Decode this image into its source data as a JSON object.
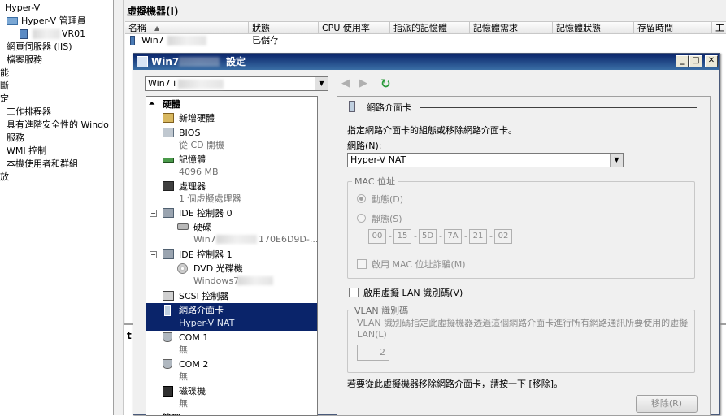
{
  "left_tree": {
    "items": [
      {
        "label": "Hyper-V",
        "indent": 6
      },
      {
        "label": "Hyper-V 管理員",
        "indent": 26
      },
      {
        "label": "VR01",
        "indent": 76
      },
      {
        "label": "網頁伺服器 (IIS)",
        "indent": 8
      },
      {
        "label": "檔案服務",
        "indent": 8
      },
      {
        "label": "能",
        "indent": 0
      },
      {
        "label": "斷",
        "indent": 0
      },
      {
        "label": "定",
        "indent": 0
      },
      {
        "label": "工作排程器",
        "indent": 8
      },
      {
        "label": "具有進階安全性的 Windo",
        "indent": 8
      },
      {
        "label": "服務",
        "indent": 8
      },
      {
        "label": "WMI 控制",
        "indent": 8
      },
      {
        "label": "本機使用者和群組",
        "indent": 8
      },
      {
        "label": "放",
        "indent": 0
      }
    ]
  },
  "vm_panel": {
    "title": "虛擬機器(I)",
    "columns": [
      "名稱",
      "狀態",
      "CPU 使用率",
      "指派的記憶體",
      "記憶體需求",
      "記憶體狀態",
      "存留時間",
      "工"
    ],
    "rows": [
      {
        "name": "Win7",
        "status": "已儲存"
      }
    ],
    "lower_pane_label": "t"
  },
  "dialog": {
    "title_left": "Win7",
    "title_right": "設定",
    "vm_select_value": "Win7 i",
    "window_buttons": {
      "minimize": "_",
      "maximize": "□",
      "close": "✕"
    },
    "hardware": [
      {
        "label": "硬體",
        "type": "section"
      },
      {
        "label": "新增硬體",
        "sub": ""
      },
      {
        "label": "BIOS",
        "sub": "從 CD 開機"
      },
      {
        "label": "記憶體",
        "sub": "4096 MB"
      },
      {
        "label": "處理器",
        "sub": "1 個虛擬處理器"
      },
      {
        "label": "IDE 控制器 0",
        "sub": ""
      },
      {
        "label": "硬碟",
        "sub": "Win7",
        "sub2": "170E6D9D-..."
      },
      {
        "label": "IDE 控制器 1",
        "sub": ""
      },
      {
        "label": "DVD 光碟機",
        "sub": "Windows7"
      },
      {
        "label": "SCSI 控制器",
        "sub": ""
      },
      {
        "label": "網路介面卡",
        "sub": "Hyper-V NAT"
      },
      {
        "label": "COM 1",
        "sub": "無"
      },
      {
        "label": "COM 2",
        "sub": "無"
      },
      {
        "label": "磁碟機",
        "sub": "無"
      },
      {
        "label": "管理",
        "type": "section"
      }
    ],
    "network": {
      "heading": "網路介面卡",
      "description": "指定網路介面卡的組態或移除網路介面卡。",
      "network_label": "網路(N):",
      "network_value": "Hyper-V NAT",
      "mac_group_label": "MAC 位址",
      "mac_dynamic": "動態(D)",
      "mac_static": "靜態(S)",
      "mac_octets": [
        "00",
        "15",
        "5D",
        "7A",
        "21",
        "02"
      ],
      "mac_spoof": "啟用 MAC 位址詐騙(M)",
      "vlan_enable": "啟用虛擬 LAN 識別碼(V)",
      "vlan_group_label": "VLAN 識別碼",
      "vlan_desc": "VLAN 識別碼指定此虛擬機器透過這個網路介面卡進行所有網路通訊所要使用的虛擬 LAN(L)",
      "vlan_value": "2",
      "remove_hint": "若要從此虛擬機器移除網路介面卡，請按一下 [移除]。",
      "remove_button": "移除(R)"
    }
  }
}
